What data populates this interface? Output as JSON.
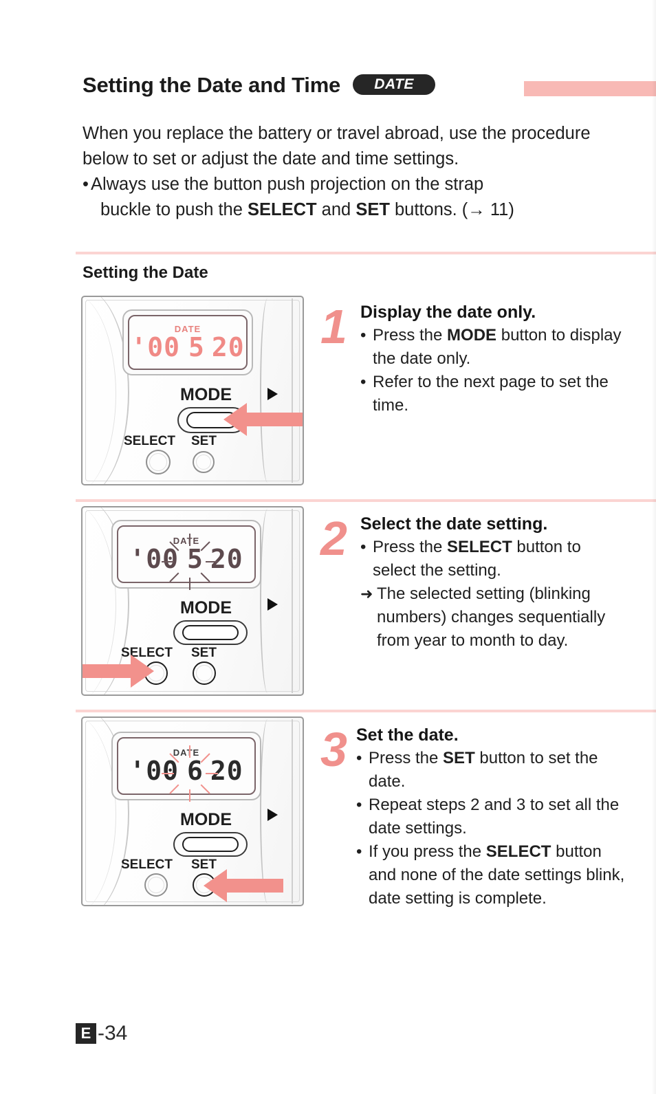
{
  "page": {
    "title": "Setting the Date and Time",
    "badge_label": "DATE",
    "footer_chip": "E",
    "footer_number": "-34",
    "accent_pink": "#f8b9b5",
    "rule_pink": "#fbd4d2",
    "step_number_color": "#f0908c",
    "lcd_red": "#f08a86"
  },
  "intro": {
    "paragraph": "When you replace the battery or travel abroad, use the procedure below to set or adjust the date and time settings.",
    "bullet_mark": "•",
    "bullet_part1": "Always use the button push projection on the strap",
    "bullet_part2_pre": "buckle to push the ",
    "bullet_select": "SELECT",
    "bullet_mid": " and ",
    "bullet_set": "SET",
    "bullet_part2_post": " buttons. (→ 11)"
  },
  "section": {
    "heading": "Setting the Date"
  },
  "steps": [
    {
      "number": "1",
      "title": "Display the date only.",
      "bullets": [
        {
          "mark": "•",
          "pre": "Press the ",
          "strong": "MODE",
          "post": " button to display the date only."
        },
        {
          "mark": "•",
          "pre": "Refer to the next page to set the time.",
          "strong": "",
          "post": ""
        }
      ],
      "illustration": {
        "lcd_label": "DATE",
        "lcd_year": "'00",
        "lcd_month": "5",
        "lcd_day": "20",
        "lcd_style": "red",
        "blink_target": "none",
        "mode_label": "MODE",
        "select_label": "SELECT",
        "set_label": "SET",
        "arrow_target": "MODE",
        "arrow_direction": "left"
      }
    },
    {
      "number": "2",
      "title": "Select the date setting.",
      "bullets": [
        {
          "mark": "•",
          "pre": "Press the ",
          "strong": "SELECT",
          "post": " button to select the setting."
        },
        {
          "mark": "➜",
          "pre": "The selected setting (blinking numbers) changes sequentially from year to month to day.",
          "strong": "",
          "post": ""
        }
      ],
      "illustration": {
        "lcd_label": "DATE",
        "lcd_year": "'00",
        "lcd_month": "5",
        "lcd_day": "20",
        "lcd_style": "dark",
        "blink_target": "month",
        "mode_label": "MODE",
        "select_label": "SELECT",
        "set_label": "SET",
        "arrow_target": "SELECT",
        "arrow_direction": "right"
      }
    },
    {
      "number": "3",
      "title": "Set the date.",
      "bullets": [
        {
          "mark": "•",
          "pre": "Press the ",
          "strong": "SET",
          "post": " button to set the date."
        },
        {
          "mark": "•",
          "pre": "Repeat steps 2 and 3 to set all the date settings.",
          "strong": "",
          "post": ""
        },
        {
          "mark": "•",
          "pre": "If you press the ",
          "strong": "SELECT",
          "post": " button and none of the date settings blink, date setting is complete."
        }
      ],
      "illustration": {
        "lcd_label": "DATE",
        "lcd_year": "'00",
        "lcd_month": "6",
        "lcd_day": "20",
        "lcd_style": "black",
        "blink_target": "month",
        "mode_label": "MODE",
        "select_label": "SELECT",
        "set_label": "SET",
        "arrow_target": "SET",
        "arrow_direction": "left"
      }
    }
  ]
}
